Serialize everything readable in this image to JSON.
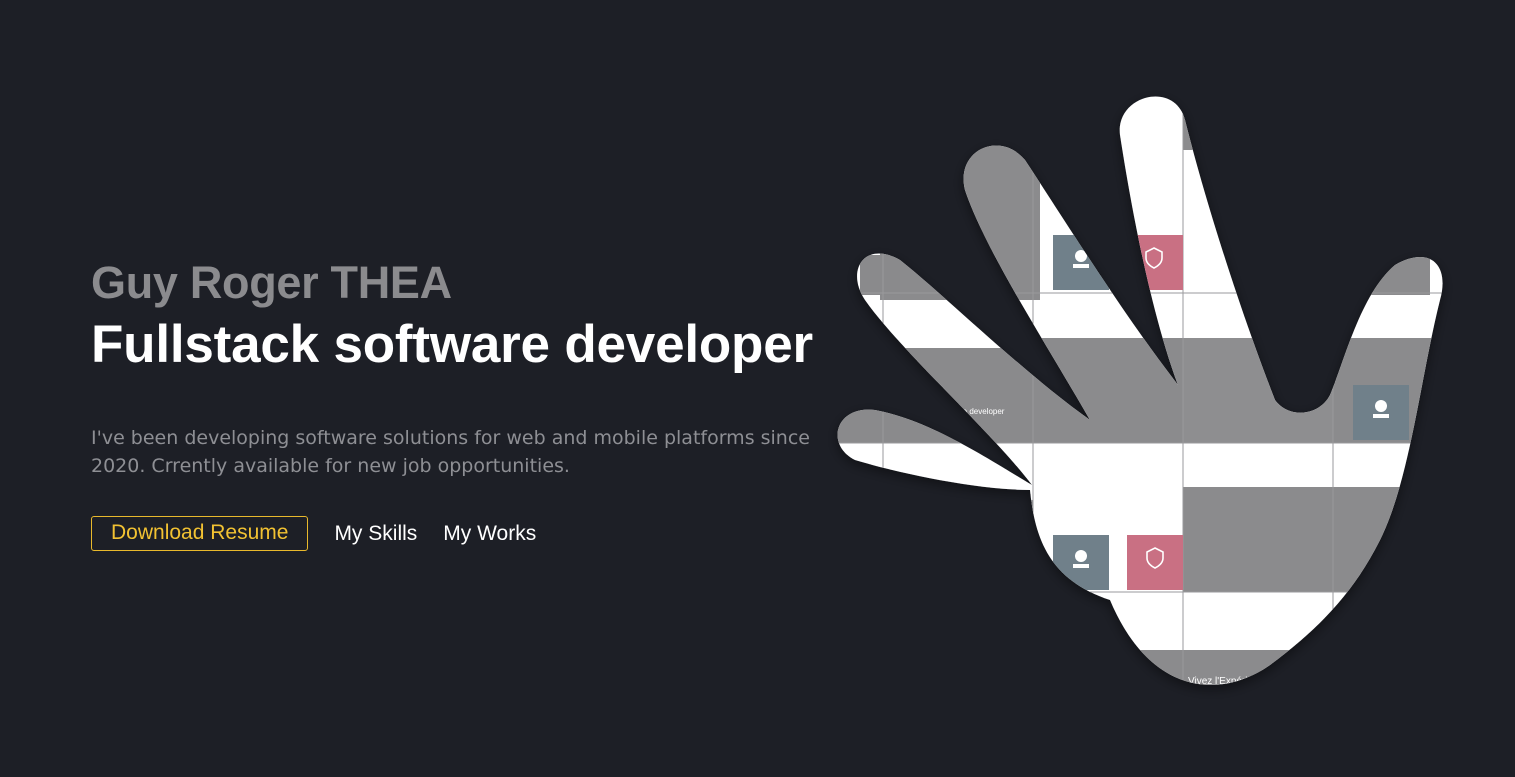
{
  "hero": {
    "name": "Guy Roger THEA",
    "role": "Fullstack software developer",
    "bio": "I've been developing software solutions for web and mobile platforms since 2020. Crrently available for new job opportunities."
  },
  "actions": {
    "download_resume": "Download Resume",
    "skills": "My Skills",
    "works": "My Works"
  },
  "collage": {
    "snippet_dev": "re developer",
    "snippet_promo": "Vivez l'Expérie…",
    "colors": {
      "background": "#1d1f26",
      "accent": "#e8b92c",
      "tile_grey": "#8a8a8c",
      "tile_white": "#ffffff",
      "badge_slate": "#6f808a",
      "badge_pink": "#c96f83"
    }
  }
}
